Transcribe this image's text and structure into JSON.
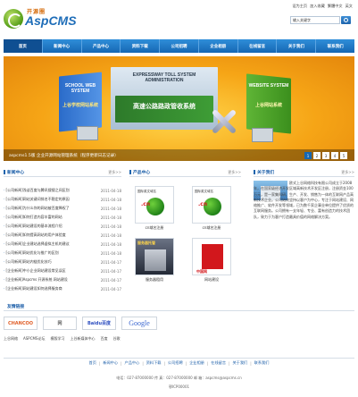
{
  "header": {
    "logo_cn": "开源圈",
    "logo_en": "AspCMS",
    "toplinks": [
      "设为主页",
      "加入收藏",
      "繁體中文",
      "英文"
    ],
    "search_placeholder": "输入关键字"
  },
  "nav": {
    "items": [
      "首页",
      "新闻中心",
      "产品中心",
      "资料下载",
      "公司招聘",
      "企业相册",
      "在线留言",
      "关于我们",
      "联系我们"
    ]
  },
  "banner": {
    "box1_title": "SCHOOL WEB SYSTEM",
    "box1_sub": "上谷学校网站系统",
    "box2_title": "EXPRESSWAY TOLL SYSTEM ADMINISTRATION",
    "box2_sub": "高速公路路政管收系统",
    "box3_title": "WEBSITE SYSTEM",
    "box3_sub": "上谷网站系统",
    "caption": "aspcms1.5版 企业开源网站管理系统（程序更新日志记录）",
    "slides": [
      "1",
      "2",
      "3",
      "4",
      "5"
    ],
    "active_slide": 1
  },
  "news": {
    "title": "新闻中心",
    "more": "更多>>",
    "items": [
      {
        "title": "[公司新闻]浅谈百度与腾讯搜搜之间区别",
        "date": "2011-04-18"
      },
      {
        "title": "[公司新闻]网站关键词排名不稳定的原因",
        "date": "2011-04-18"
      },
      {
        "title": "[公司新闻]为什么你的网站被百度降权了",
        "date": "2011-04-18"
      },
      {
        "title": "[公司新闻]如何打造内容丰富的网站",
        "date": "2011-04-18"
      },
      {
        "title": "[公司新闻]网站建设的基本流程介绍",
        "date": "2011-04-18"
      },
      {
        "title": "[公司新闻]如何提高网站的用户体验度",
        "date": "2011-04-18"
      },
      {
        "title": "[公司新闻]企业建站选择虚拟主机的建议",
        "date": "2011-04-18"
      },
      {
        "title": "[公司新闻]网站优化与推广的区别",
        "date": "2011-04-18"
      },
      {
        "title": "[公司新闻]网站内链优化技巧",
        "date": "2011-04-17"
      },
      {
        "title": "[企业新闻]中小企业网站建设常见误区",
        "date": "2011-04-17"
      },
      {
        "title": "[企业新闻]Aspcms 开源系统 网站建设",
        "date": "2011-04-17"
      },
      {
        "title": "[企业新闻]网站建设如何选择服务商",
        "date": "2011-04-17"
      }
    ]
  },
  "products": {
    "title": "产品中心",
    "more": "更多>>",
    "items": [
      {
        "caption": "cn域名注册",
        "img_label": "国际英文域名"
      },
      {
        "caption": "cn域名注册",
        "img_label": "国际英文域名"
      },
      {
        "caption": "服务器租用",
        "img_label": "服务器托管"
      },
      {
        "caption": "网站建设",
        "img_label": "中国网"
      }
    ]
  },
  "about": {
    "title": "关于我们",
    "more": "更多>>",
    "text": "欧式上谷网络科技有限公司成立于2008年，在国家级经济开发区域高新技术开发区注册，注册资金100万元，是一家集科研、生产、开发、销售为一体的互联网产品高新技术企业。公司始终坚持以客户为中心，专注于网站建设、网络推广、软件开发等领域，已为数千家企事业单位提供了优质的互联网服务。公司拥有一支年轻、专业、富有创造力的技术团队，致力于为客户打造最具价值的网络解决方案。"
  },
  "links": {
    "title": "友情链接",
    "logos": [
      "CHANCOO",
      "网",
      "Baidu百度",
      "Google"
    ],
    "text_links": [
      "上谷网络",
      "ASPCMS论坛",
      "模版学习",
      "上谷新媒体中心",
      "百度",
      "谷歌"
    ]
  },
  "footer": {
    "nav": [
      "首页",
      "新闻中心",
      "产品中心",
      "资料下载",
      "公司招聘",
      "企业相册",
      "在线留言",
      "关于我们",
      "联系我们"
    ],
    "contact": "电话：027-87000000  传 真：027-87000000  邮 箱：aspcms@aspcms.cn",
    "icp": "鄂ICP00001"
  },
  "colors": {
    "nav_bg": "#1667b3",
    "accent": "#1d5fa9",
    "banner_bg": "#f6a516"
  }
}
